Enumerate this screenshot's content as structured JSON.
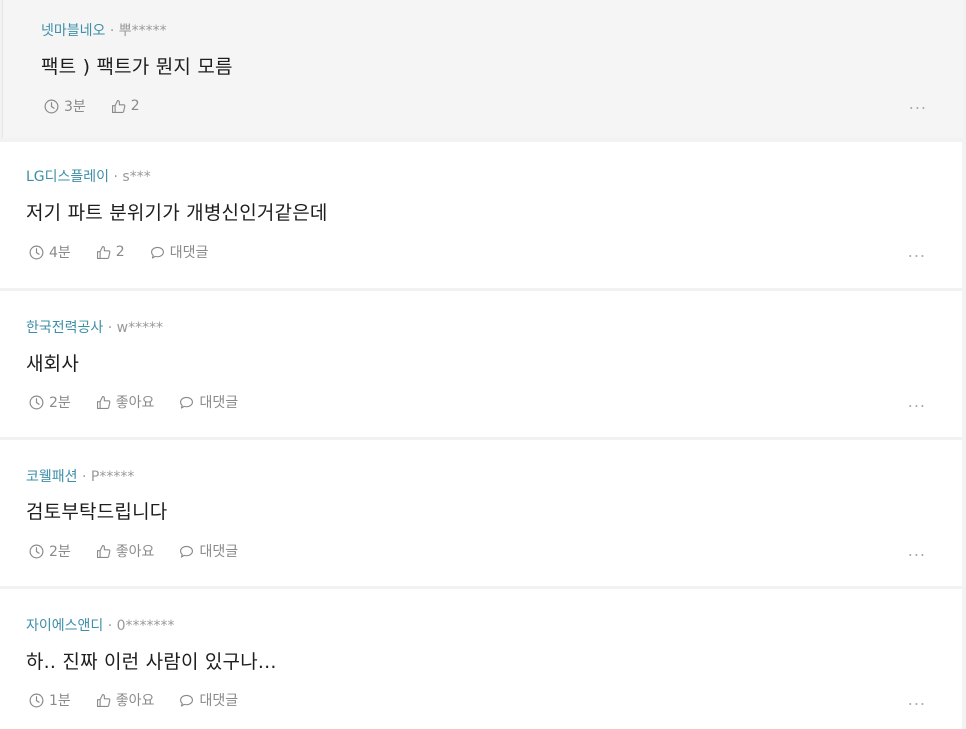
{
  "comments": [
    {
      "company": "넷마블네오",
      "user": "뿌*****",
      "text": "팩트 ) 팩트가 뭔지 모름",
      "time": "3분",
      "like": "2",
      "reply": "",
      "more": "..."
    },
    {
      "company": "LG디스플레이",
      "user": "s***",
      "text": "저기 파트 분위기가 개병신인거같은데",
      "time": "4분",
      "like": "2",
      "reply": "대댓글",
      "more": "..."
    },
    {
      "company": "한국전력공사",
      "user": "w*****",
      "text": "새회사",
      "time": "2분",
      "like": "좋아요",
      "reply": "대댓글",
      "more": "..."
    },
    {
      "company": "코웰패션",
      "user": "P*****",
      "text": "검토부탁드립니다",
      "time": "2분",
      "like": "좋아요",
      "reply": "대댓글",
      "more": "..."
    },
    {
      "company": "자이에스앤디",
      "user": "0*******",
      "text": "하.. 진짜 이런 사람이 있구나...",
      "time": "1분",
      "like": "좋아요",
      "reply": "대댓글",
      "more": "..."
    }
  ],
  "meta_separator": " · ",
  "icons": {
    "time": "clock-icon",
    "like": "thumbs-up-icon",
    "reply": "speech-bubble-icon"
  }
}
